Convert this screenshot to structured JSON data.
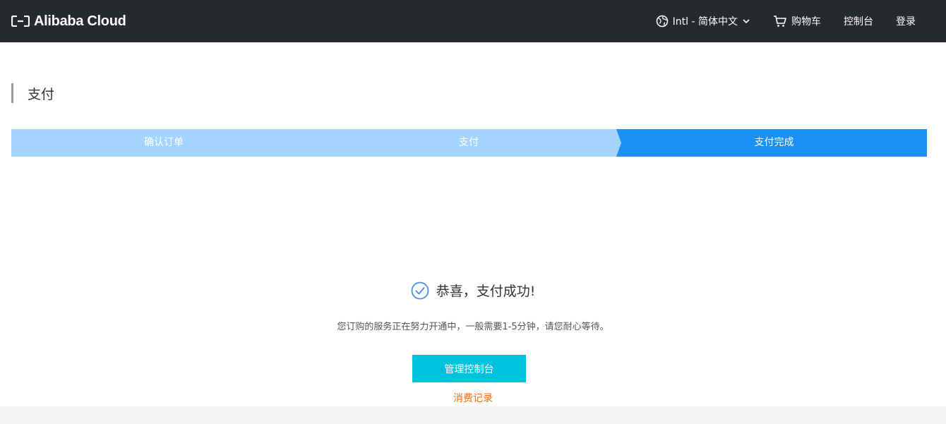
{
  "header": {
    "brand": "Alibaba Cloud",
    "language_label": "Intl - 简体中文",
    "cart_label": "购物车",
    "console_label": "控制台",
    "login_label": "登录"
  },
  "page": {
    "title": "支付"
  },
  "steps": [
    {
      "label": "确认订单",
      "state": "done"
    },
    {
      "label": "支付",
      "state": "done"
    },
    {
      "label": "支付完成",
      "state": "active"
    }
  ],
  "result": {
    "title": "恭喜，支付成功!",
    "message": "您订购的服务正在努力开通中，一般需要1-5分钟，请您耐心等待。",
    "primary_button": "管理控制台",
    "secondary_link": "消费记录"
  },
  "colors": {
    "topbar": "#26292e",
    "step_done": "#a4d3fb",
    "step_active": "#1a8ff5",
    "primary_button": "#00c1de",
    "link": "#ff6a00",
    "success_icon": "#4a90e2"
  }
}
